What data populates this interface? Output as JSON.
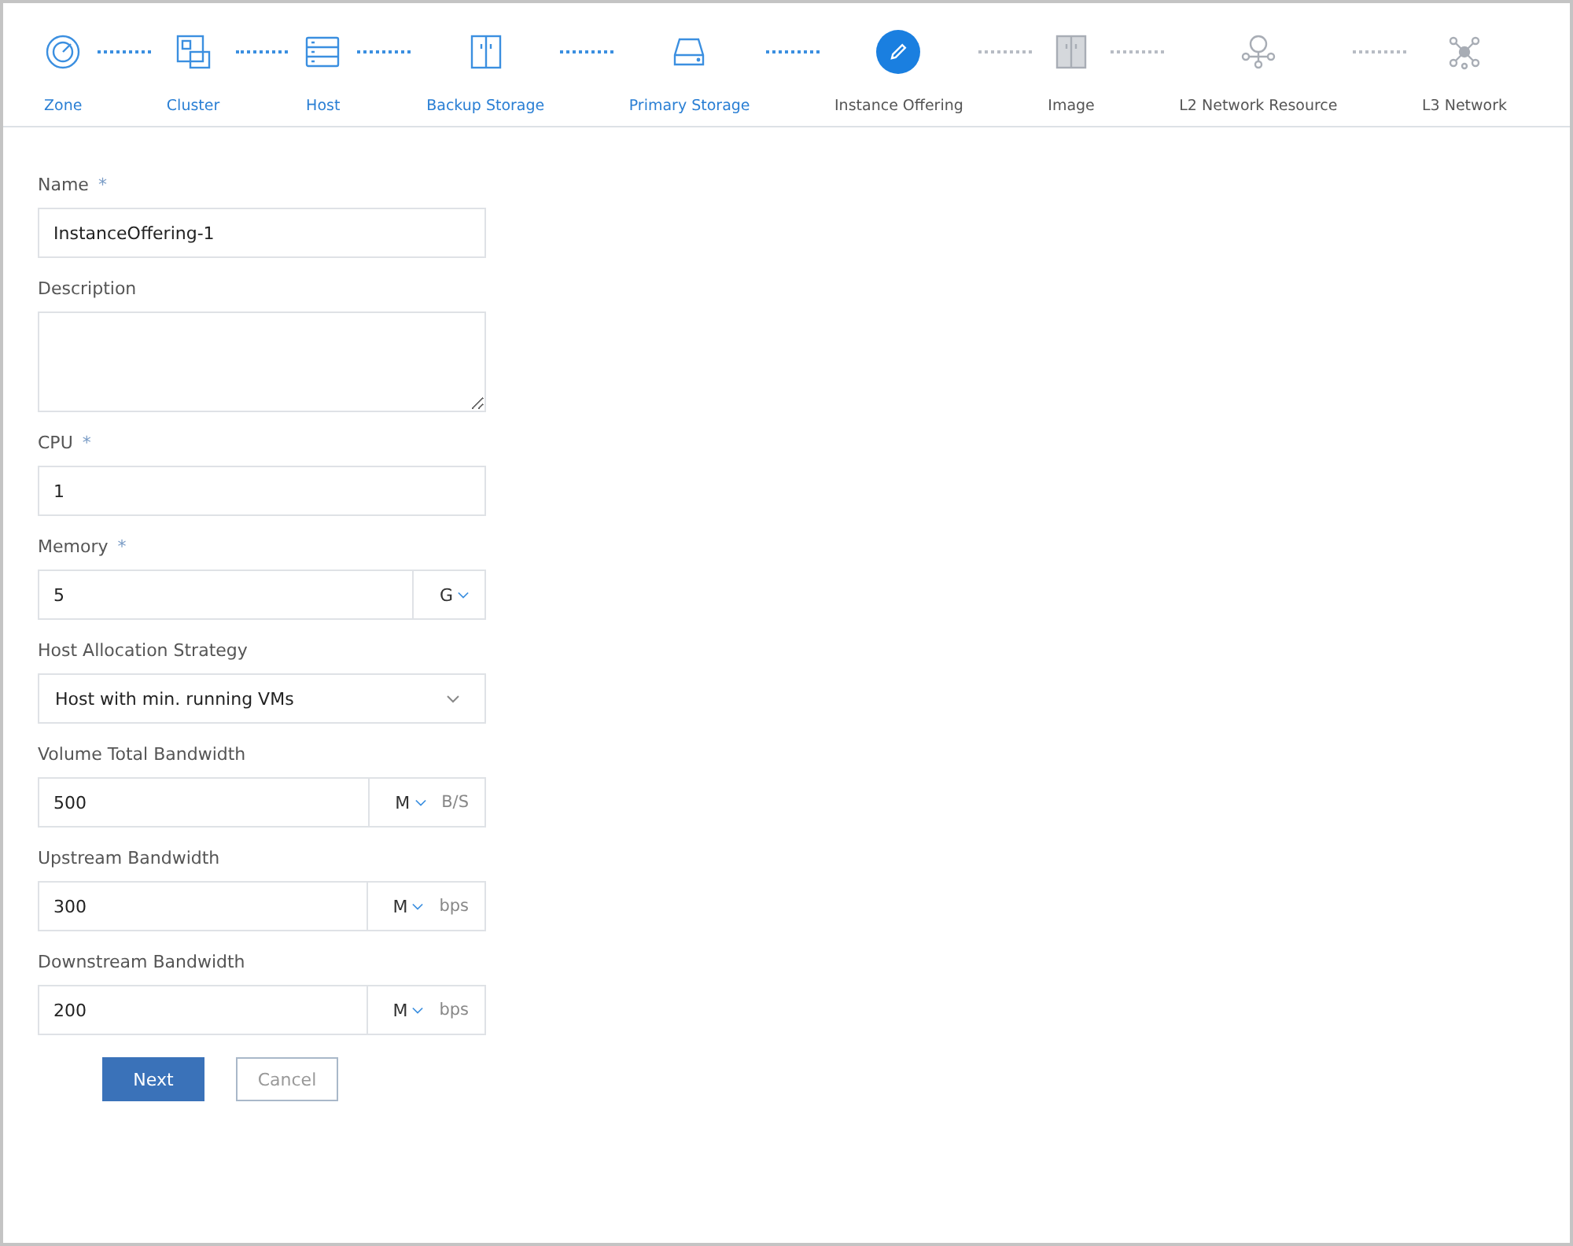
{
  "steps": [
    {
      "label": "Zone",
      "completed": true,
      "selected": false
    },
    {
      "label": "Cluster",
      "completed": true,
      "selected": false
    },
    {
      "label": "Host",
      "completed": true,
      "selected": false
    },
    {
      "label": "Backup Storage",
      "completed": true,
      "selected": false
    },
    {
      "label": "Primary Storage",
      "completed": true,
      "selected": false
    },
    {
      "label": "Instance Offering",
      "completed": false,
      "selected": true
    },
    {
      "label": "Image",
      "completed": false,
      "selected": false
    },
    {
      "label": "L2 Network Resource",
      "completed": false,
      "selected": false
    },
    {
      "label": "L3 Network",
      "completed": false,
      "selected": false
    }
  ],
  "form": {
    "fields": [
      {
        "kind": "text",
        "label": "Name",
        "required_mark": "*",
        "value": "InstanceOffering-1"
      },
      {
        "kind": "textarea",
        "label": "Description"
      },
      {
        "kind": "text",
        "label": "CPU",
        "required_mark": "*",
        "value": "1"
      },
      {
        "kind": "unit",
        "label": "Memory",
        "required_mark": "*",
        "value": "5",
        "unit": "G"
      },
      {
        "kind": "select",
        "label": "Host Allocation Strategy",
        "value": "Host with min. running VMs"
      },
      {
        "kind": "unit",
        "label": "Volume Total Bandwidth",
        "value": "500",
        "unit": "M",
        "suffix": "B/S"
      },
      {
        "kind": "unit",
        "label": "Upstream Bandwidth",
        "value": "300",
        "unit": "M",
        "suffix": "bps"
      },
      {
        "kind": "unit",
        "label": "Downstream Bandwidth",
        "value": "200",
        "unit": "M",
        "suffix": "bps"
      }
    ],
    "buttons": [
      {
        "label": "Next",
        "kind": "primary"
      },
      {
        "label": "Cancel",
        "kind": "secondary"
      }
    ]
  }
}
